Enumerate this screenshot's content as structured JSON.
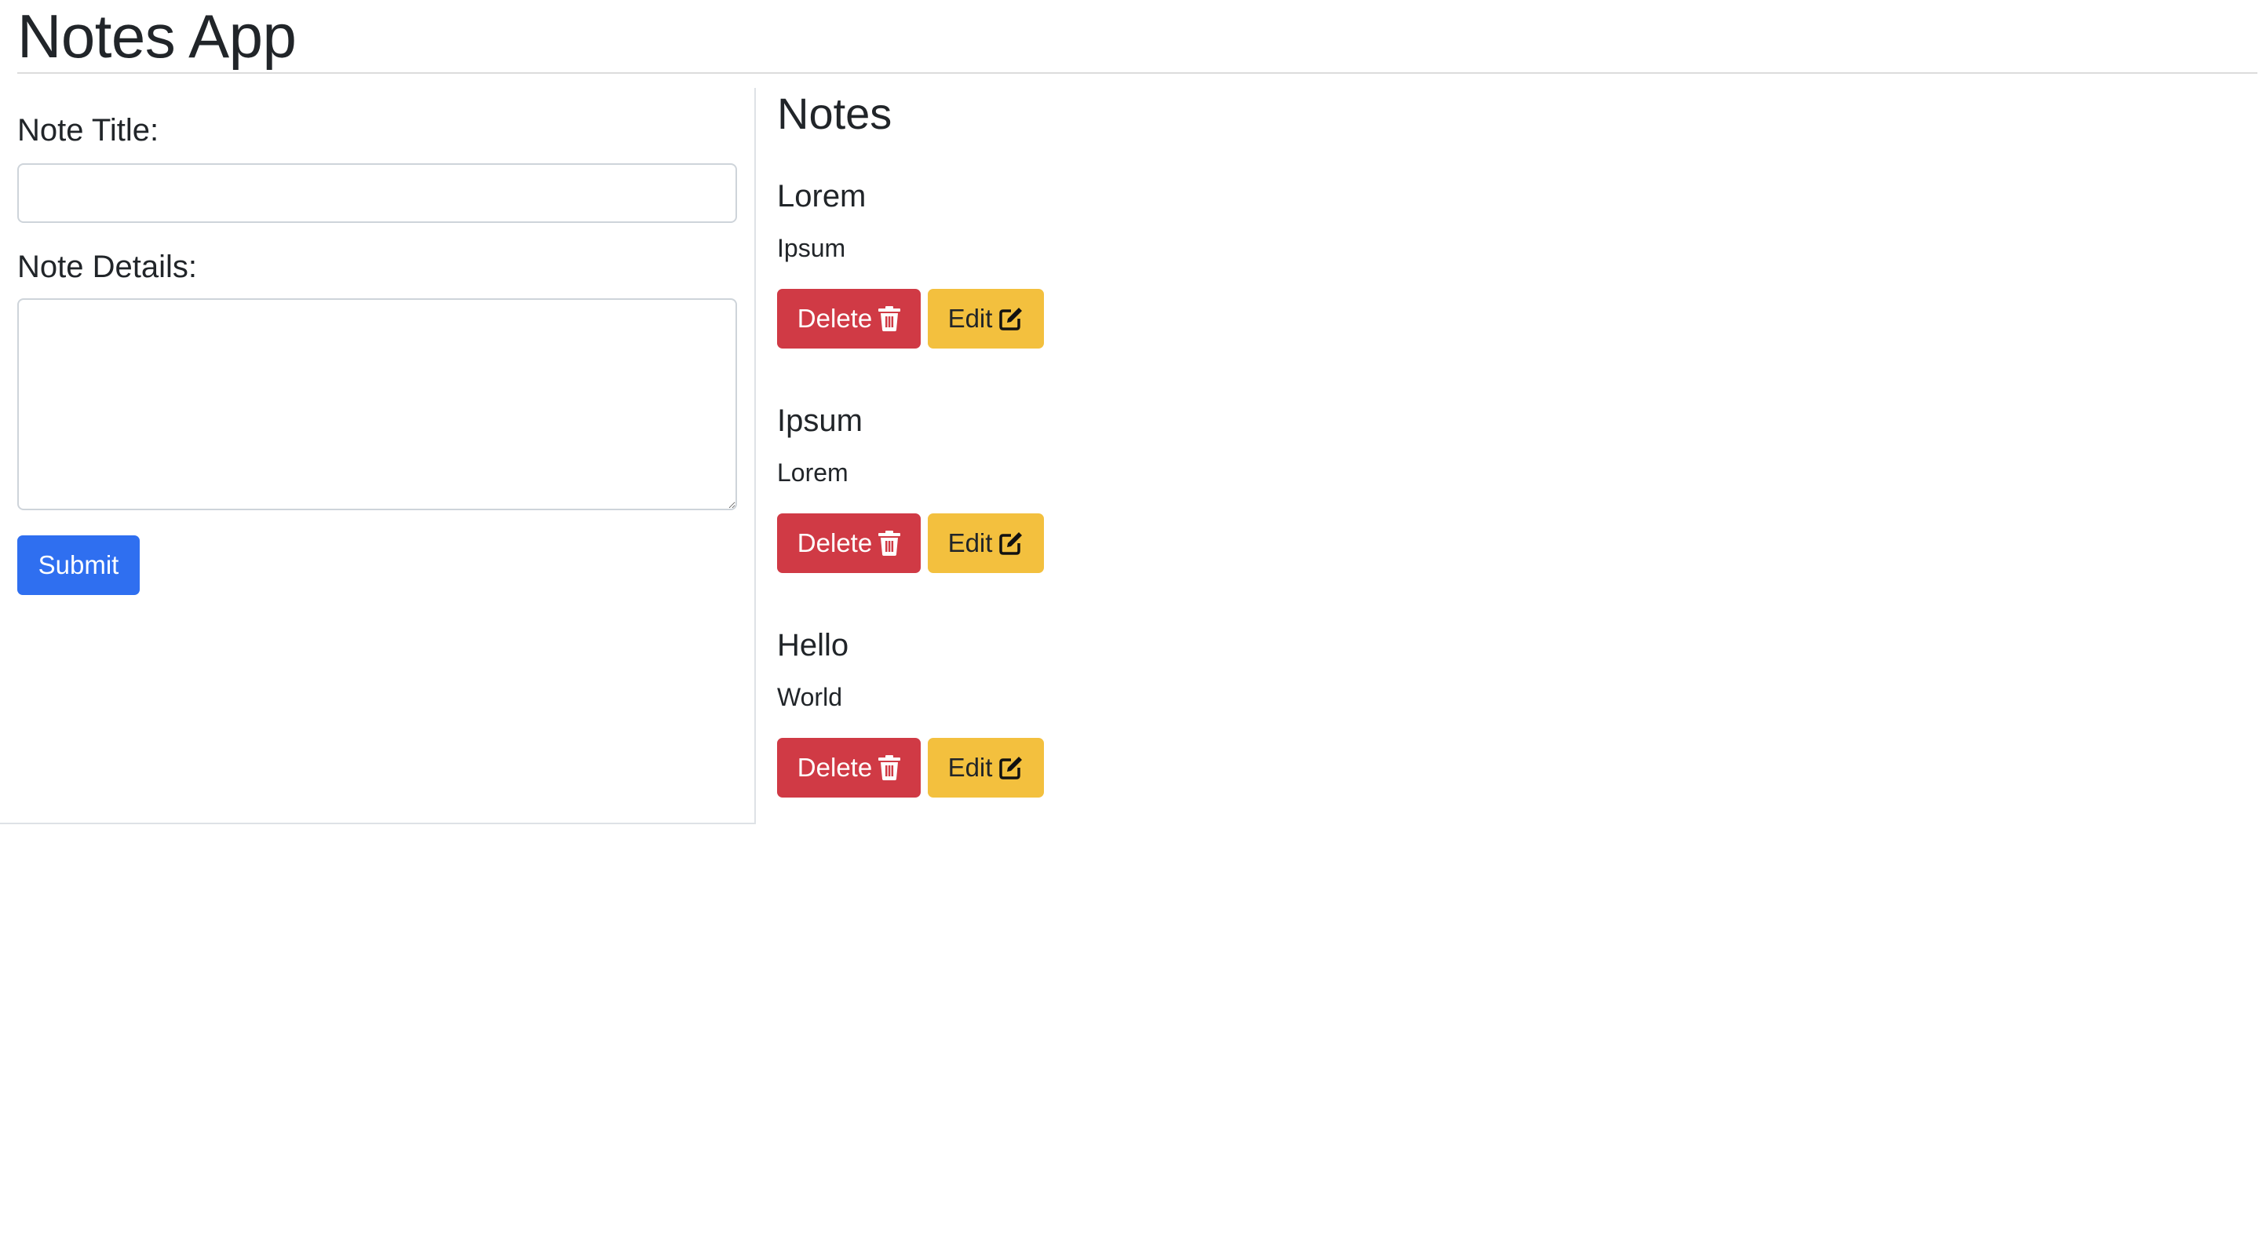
{
  "app": {
    "title": "Notes App"
  },
  "form": {
    "title_label": "Note Title:",
    "title_value": "",
    "details_label": "Note Details:",
    "details_value": "",
    "submit_label": "Submit"
  },
  "notes_section": {
    "heading": "Notes",
    "delete_label": "Delete",
    "edit_label": "Edit",
    "delete_icon": "trash-icon",
    "edit_icon": "edit-icon",
    "items": [
      {
        "title": "Lorem",
        "body": "Ipsum"
      },
      {
        "title": "Ipsum",
        "body": "Lorem"
      },
      {
        "title": "Hello",
        "body": "World"
      }
    ]
  },
  "colors": {
    "primary": "#2f6ff0",
    "danger": "#d03a45",
    "warning": "#f3c03e",
    "text": "#212529"
  }
}
